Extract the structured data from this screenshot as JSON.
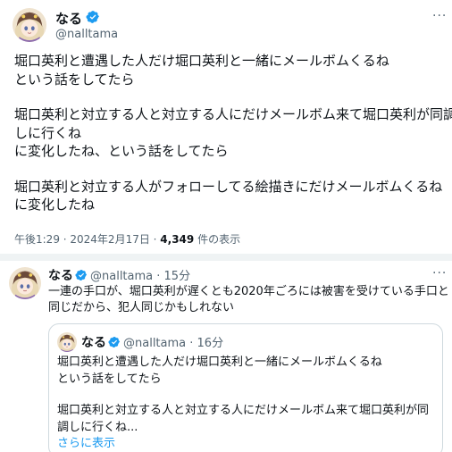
{
  "colors": {
    "accent": "#1d9bf0",
    "text": "#0f1419",
    "muted": "#536471",
    "border": "#cfd9de"
  },
  "icons": {
    "verified": "verified-badge-icon",
    "more": "more-options-icon",
    "avatar": "anime-girl-avatar"
  },
  "tweet": {
    "display_name": "なる",
    "handle": "@nalltama",
    "more": "···",
    "body": [
      "堀口英利と遭遇した人だけ堀口英利と一緒にメールボムくるね",
      "という話をしてたら",
      "",
      "堀口英利と対立する人と対立する人にだけメールボム来て堀口英利が同調",
      "しに行くね",
      "に変化したね、という話をしてたら",
      "",
      "堀口英利と対立する人がフォローしてる絵描きにだけメールボムくるね",
      "に変化したね"
    ],
    "timestamp": "午後1:29 · 2024年2月17日 · ",
    "views_count": "4,349",
    "views_label": " 件の表示"
  },
  "reply": {
    "display_name": "なる",
    "handle": "@nalltama",
    "time": "· 15分",
    "more": "···",
    "body": [
      "一連の手口が、堀口英利が遅くとも2020年ごろには被害を受けている手口と",
      "同じだから、犯人同じかもしれない"
    ],
    "quote": {
      "display_name": "なる",
      "handle": "@nalltama",
      "time": "· 16分",
      "body": [
        "堀口英利と遭遇した人だけ堀口英利と一緒にメールボムくるね",
        "という話をしてたら",
        "",
        "堀口英利と対立する人と対立する人にだけメールボム来て堀口英利が同",
        "調しに行くね..."
      ],
      "show_more": "さらに表示"
    }
  }
}
